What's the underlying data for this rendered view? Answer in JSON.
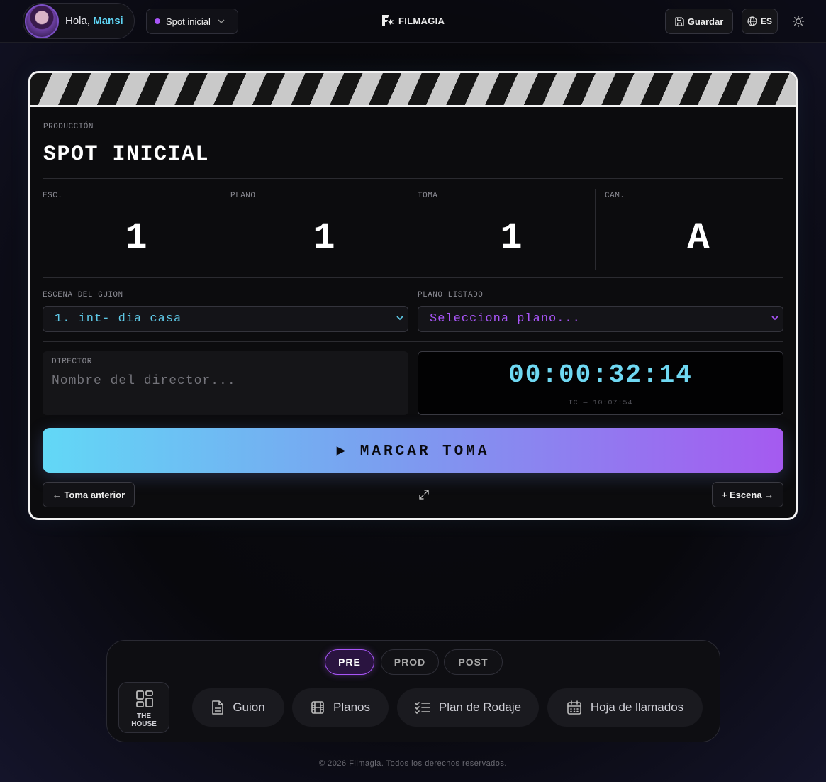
{
  "header": {
    "greeting": "Hola,",
    "user_name": "Mansi",
    "project_selector": "Spot inicial",
    "brand": "FILMAGIA",
    "save_label": "Guardar",
    "language": "ES"
  },
  "clapper": {
    "production_label": "PRODUCCIÓN",
    "production_title": "SPOT INICIAL",
    "fields": [
      {
        "label": "ESC.",
        "value": "1"
      },
      {
        "label": "PLANO",
        "value": "1"
      },
      {
        "label": "TOMA",
        "value": "1"
      },
      {
        "label": "CAM.",
        "value": "A"
      }
    ],
    "scene_label": "ESCENA DEL GUION",
    "scene_value": "1. int- dia casa",
    "shot_label": "PLANO LISTADO",
    "shot_placeholder": "Selecciona plano...",
    "director_label": "DIRECTOR",
    "director_placeholder": "Nombre del director...",
    "timecode": "00:00:32:14",
    "tc_sub": "TC — 10:07:54",
    "mark_label": "▶ MARCAR TOMA",
    "prev_take": "← Toma anterior",
    "add_scene": "+ Escena →",
    "colors": {
      "timecode": "#6fd8f2",
      "scene_select": "#5ec8e6",
      "shot_select": "#a855f7"
    }
  },
  "dock": {
    "phases": [
      "PRE",
      "PROD",
      "POST"
    ],
    "active_phase": "PRE",
    "house_label_1": "THE",
    "house_label_2": "HOUSE",
    "nav": [
      {
        "label": "Guion",
        "icon": "document-icon"
      },
      {
        "label": "Planos",
        "icon": "film-icon"
      },
      {
        "label": "Plan de Rodaje",
        "icon": "checklist-icon"
      },
      {
        "label": "Hoja de llamados",
        "icon": "calendar-icon"
      }
    ]
  },
  "footer": "© 2026 Filmagia. Todos los derechos reservados."
}
